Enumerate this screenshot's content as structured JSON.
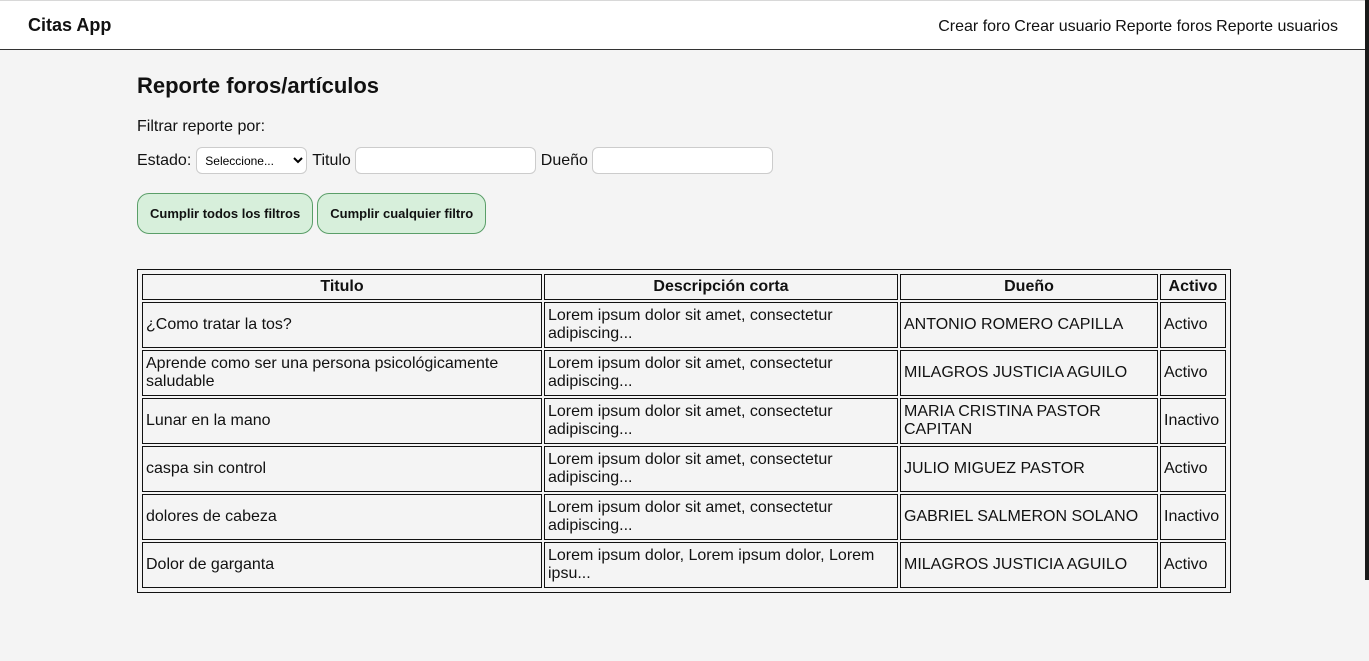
{
  "app": {
    "brand": "Citas App"
  },
  "nav": {
    "items": [
      "Crear foro",
      "Crear usuario",
      "Reporte foros",
      "Reporte usuarios"
    ]
  },
  "page": {
    "title": "Reporte foros/artículos",
    "filter_label": "Filtrar reporte por:"
  },
  "filters": {
    "estado_label": "Estado:",
    "estado_selected": "Seleccione...",
    "titulo_label": "Titulo",
    "titulo_value": "",
    "dueno_label": "Dueño",
    "dueno_value": ""
  },
  "actions": {
    "all_filters": "Cumplir todos los filtros",
    "any_filter": "Cumplir cualquier filtro"
  },
  "table": {
    "headers": [
      "Titulo",
      "Descripción corta",
      "Dueño",
      "Activo"
    ],
    "rows": [
      [
        "¿Como tratar la tos?",
        "Lorem ipsum dolor sit amet, consectetur adipiscing...",
        "ANTONIO ROMERO CAPILLA",
        "Activo"
      ],
      [
        "Aprende como ser una persona psicológicamente saludable",
        "Lorem ipsum dolor sit amet, consectetur adipiscing...",
        "MILAGROS JUSTICIA AGUILO",
        "Activo"
      ],
      [
        "Lunar en la mano",
        "Lorem ipsum dolor sit amet, consectetur adipiscing...",
        "MARIA CRISTINA PASTOR CAPITAN",
        "Inactivo"
      ],
      [
        "caspa sin control",
        "Lorem ipsum dolor sit amet, consectetur adipiscing...",
        "JULIO MIGUEZ PASTOR",
        "Activo"
      ],
      [
        "dolores de cabeza",
        "Lorem ipsum dolor sit amet, consectetur adipiscing...",
        "GABRIEL SALMERON SOLANO",
        "Inactivo"
      ],
      [
        "Dolor de garganta",
        "Lorem ipsum dolor, Lorem ipsum dolor, Lorem ipsu...",
        "MILAGROS JUSTICIA AGUILO",
        "Activo"
      ]
    ]
  },
  "colors": {
    "button_bg": "#d7efdb",
    "button_border": "#5a9e68",
    "page_bg": "#f4f4f4"
  },
  "icons": {
    "select_arrow": "chevron-down-icon"
  }
}
